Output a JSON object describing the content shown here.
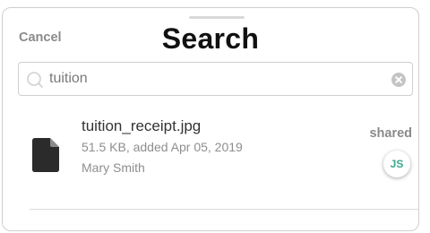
{
  "header": {
    "cancel_label": "Cancel",
    "title": "Search"
  },
  "search": {
    "value": "tuition",
    "icon": "search-icon",
    "clear_icon": "clear-icon"
  },
  "results": [
    {
      "name": "tuition_receipt.jpg",
      "size": "51.5 KB",
      "added": "added Apr 05, 2019",
      "owner": "Mary Smith",
      "shared_label": "shared",
      "avatar_initials": "JS",
      "icon": "file-icon"
    }
  ],
  "colors": {
    "avatar_text": "#3aa98c",
    "secondary_text": "#8e8e8e"
  }
}
